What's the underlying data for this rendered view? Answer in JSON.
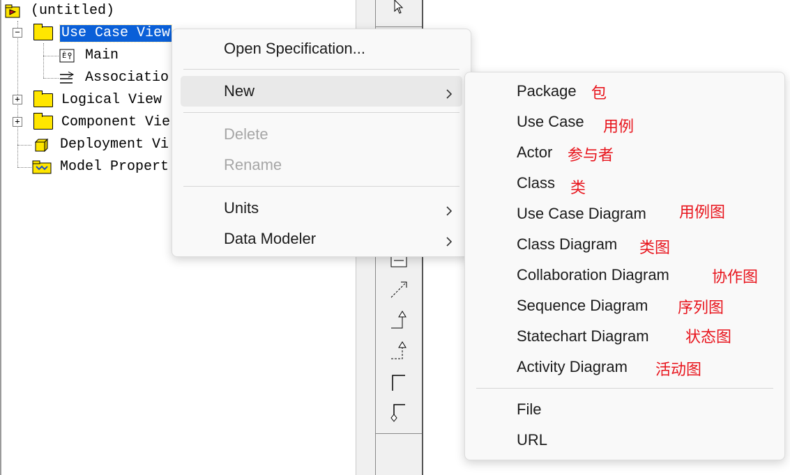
{
  "tree": {
    "root": "(untitled)",
    "items": [
      {
        "label": "Use Case View",
        "expander": "−"
      },
      {
        "label": "Main"
      },
      {
        "label": "Associatio"
      },
      {
        "label": "Logical View",
        "expander": "+"
      },
      {
        "label": "Component Vie",
        "expander": "+"
      },
      {
        "label": "Deployment Vi"
      },
      {
        "label": "Model Propert"
      }
    ]
  },
  "context_menu": {
    "items": [
      {
        "label": "Open Specification...",
        "enabled": true
      },
      {
        "label": "New",
        "enabled": true,
        "submenu": true,
        "highlighted": true
      },
      {
        "label": "Delete",
        "enabled": false
      },
      {
        "label": "Rename",
        "enabled": false
      },
      {
        "label": "Units",
        "enabled": true,
        "submenu": true
      },
      {
        "label": "Data Modeler",
        "enabled": true,
        "submenu": true
      }
    ]
  },
  "submenu_new": {
    "items": [
      {
        "label": "Package",
        "annotation": "包"
      },
      {
        "label": "Use Case",
        "annotation": "用例"
      },
      {
        "label": "Actor",
        "annotation": "参与者"
      },
      {
        "label": "Class",
        "annotation": "类"
      },
      {
        "label": "Use Case Diagram",
        "annotation": "用例图"
      },
      {
        "label": "Class Diagram",
        "annotation": "类图"
      },
      {
        "label": "Collaboration Diagram",
        "annotation": "协作图"
      },
      {
        "label": "Sequence Diagram",
        "annotation": "序列图"
      },
      {
        "label": "Statechart Diagram",
        "annotation": "状态图"
      },
      {
        "label": "Activity Diagram",
        "annotation": "活动图"
      },
      {
        "label": "File",
        "annotation": ""
      },
      {
        "label": "URL",
        "annotation": ""
      }
    ]
  },
  "colors": {
    "selection": "#0a5fd8",
    "annotation": "#e8141c",
    "folder": "#ffe600",
    "menu_bg": "#f9f9f9",
    "menu_hover": "#e9e9e9"
  }
}
